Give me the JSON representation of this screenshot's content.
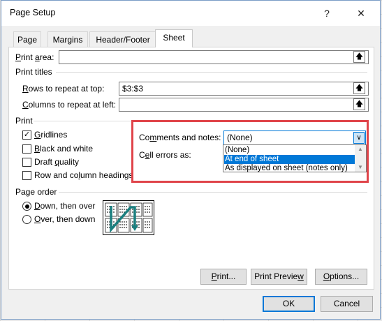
{
  "dialog": {
    "title": "Page Setup",
    "help": "?",
    "close": "✕",
    "tabs": [
      "Page",
      "Margins",
      "Header/Footer",
      "Sheet"
    ]
  },
  "sheet": {
    "print_area_label": "Print area:",
    "print_area_value": "",
    "print_titles_heading": "Print titles",
    "rows_label": "Rows to repeat at top:",
    "rows_value": "$3:$3",
    "cols_label": "Columns to repeat at left:",
    "cols_value": "",
    "print_heading": "Print",
    "checkboxes": [
      {
        "label": "Gridlines",
        "checked": true
      },
      {
        "label": "Black and white",
        "checked": false
      },
      {
        "label": "Draft quality",
        "checked": false
      },
      {
        "label": "Row and column headings",
        "checked": false
      }
    ],
    "comments_label": "Comments and notes:",
    "comments_value": "(None)",
    "comments_options": [
      "(None)",
      "At end of sheet",
      "As displayed on sheet (notes only)"
    ],
    "comments_highlighted": "At end of sheet",
    "cell_errors_label": "Cell errors as:",
    "page_order_heading": "Page order",
    "page_order_options": [
      {
        "label": "Down, then over",
        "selected": true
      },
      {
        "label": "Over, then down",
        "selected": false
      }
    ]
  },
  "buttons": {
    "print": "Print...",
    "print_preview": "Print Preview",
    "options": "Options...",
    "ok": "OK",
    "cancel": "Cancel"
  },
  "icons": {
    "collapse": "collapse-dialog-icon",
    "checkmark": "✓",
    "dropdown": "chevron-down-icon"
  }
}
